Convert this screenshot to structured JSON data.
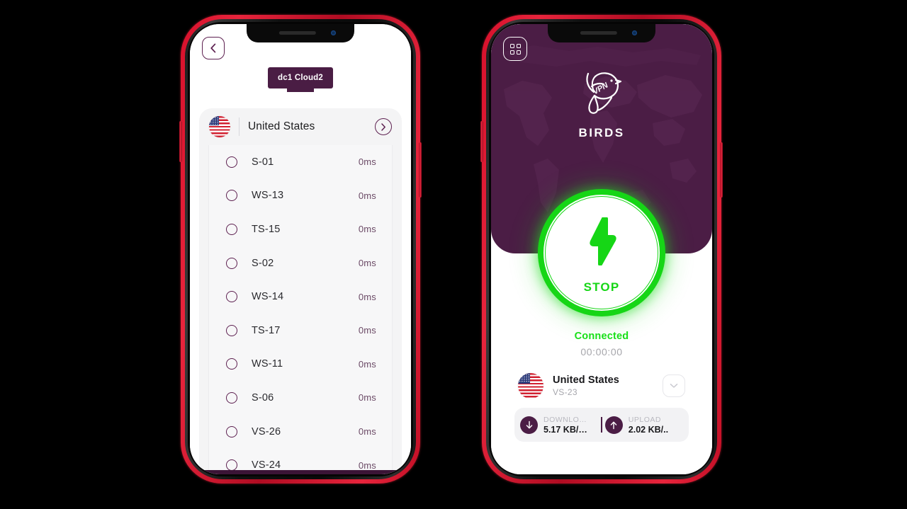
{
  "theme": {
    "purple": "#4b1d45",
    "green": "#16d616",
    "frame_red": "#d6102b",
    "list_bg": "#f4f4f5"
  },
  "left_phone": {
    "back_button_label": "back",
    "tooltip_badge": "dc1 Cloud2",
    "country": {
      "name": "United States",
      "forward_label": "open"
    },
    "servers": [
      {
        "name": "S-01",
        "ping": "0ms"
      },
      {
        "name": "WS-13",
        "ping": "0ms"
      },
      {
        "name": "TS-15",
        "ping": "0ms"
      },
      {
        "name": "S-02",
        "ping": "0ms"
      },
      {
        "name": "WS-14",
        "ping": "0ms"
      },
      {
        "name": "TS-17",
        "ping": "0ms"
      },
      {
        "name": "WS-11",
        "ping": "0ms"
      },
      {
        "name": "S-06",
        "ping": "0ms"
      },
      {
        "name": "VS-26",
        "ping": "0ms"
      },
      {
        "name": "VS-24",
        "ping": "0ms"
      }
    ]
  },
  "right_phone": {
    "menu_button_label": "menu",
    "logo": {
      "mark_text": "VPN",
      "brand": "BIRDS"
    },
    "power": {
      "action_label": "STOP",
      "status": "Connected",
      "timer": "00:00:00"
    },
    "location": {
      "country": "United States",
      "server": "VS-23",
      "dropdown_label": "expand"
    },
    "speed": {
      "download_label": "DOWNLO…",
      "download_value": "5.17 KB/…",
      "upload_label": "UPLOAD",
      "upload_value": "2.02  KB/.."
    }
  }
}
